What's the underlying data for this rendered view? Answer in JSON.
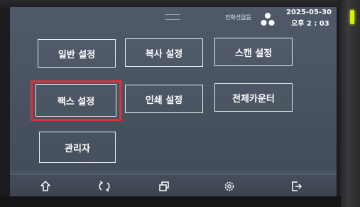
{
  "status": {
    "indicator": "전화선없음",
    "date": "2025-05-30",
    "time": "오후 2 : 03"
  },
  "menu": {
    "general": "일반 설정",
    "copy": "복사 설정",
    "scan": "스캔 설정",
    "fax": "팩스 설정",
    "print": "인쇄 설정",
    "counter": "전체카운터",
    "admin": "관리자"
  },
  "colors": {
    "highlight": "#e0303a",
    "screen_bg": "#4a5462",
    "button_border": "#e6ebf2",
    "led": "#d8f000"
  },
  "bottombar": {
    "icons": [
      "home-icon",
      "refresh-icon",
      "multitask-icon",
      "settings-gear-icon",
      "exit-icon"
    ]
  }
}
